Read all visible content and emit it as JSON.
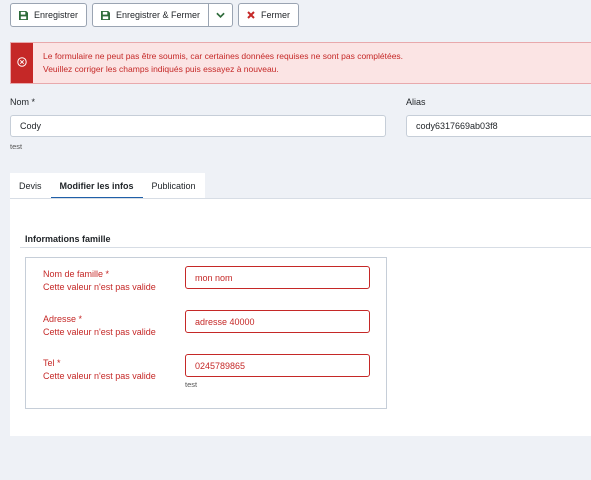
{
  "toolbar": {
    "save_label": "Enregistrer",
    "save_close_label": "Enregistrer & Fermer",
    "close_label": "Fermer"
  },
  "alert": {
    "line1": "Le formulaire ne peut pas être soumis, car certaines données requises ne sont pas complétées.",
    "line2": "Veuillez corriger les champs indiqués puis essayez à nouveau."
  },
  "form": {
    "name_label": "Nom *",
    "name_value": "Cody",
    "name_hint": "test",
    "alias_label": "Alias",
    "alias_value": "cody6317669ab03f8"
  },
  "tabs": [
    {
      "label": "Devis"
    },
    {
      "label": "Modifier les infos",
      "active": true
    },
    {
      "label": "Publication"
    }
  ],
  "panel": {
    "section_title": "Informations famille",
    "fields": [
      {
        "label": "Nom de famille *",
        "error": "Cette valeur n'est pas valide",
        "value": "mon nom"
      },
      {
        "label": "Adresse *",
        "error": "Cette valeur n'est pas valide",
        "value": "adresse 40000"
      },
      {
        "label": "Tel *",
        "error": "Cette valeur n'est pas valide",
        "value": "0245789865",
        "hint": "test"
      }
    ]
  },
  "colors": {
    "error": "#c52827",
    "tab_active": "#1f5fa8",
    "page_bg": "#eef1f6",
    "save_icon": "#2e6b3a",
    "close_icon": "#c52827"
  }
}
